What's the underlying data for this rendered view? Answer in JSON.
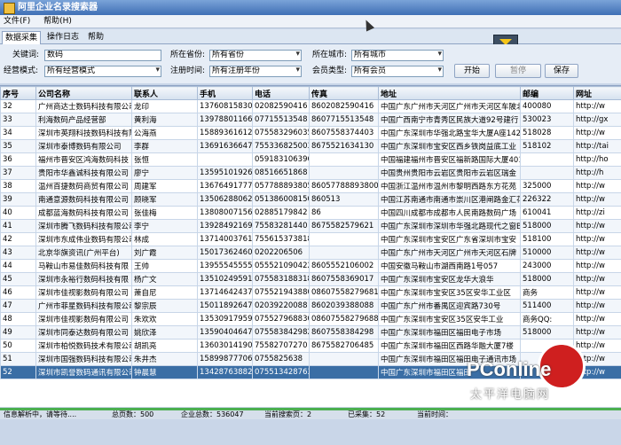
{
  "window": {
    "title": "阿里企业名录搜索器"
  },
  "menu": {
    "file": "文件(F)",
    "help": "帮助(H)"
  },
  "tabs": [
    "数据采集",
    "操作日志",
    "帮助"
  ],
  "form": {
    "keyword_label": "关键词:",
    "keyword_value": "数码",
    "province_label": "所在省份:",
    "province_value": "所有省份",
    "city_label": "所在城市:",
    "city_value": "所有城市",
    "mode_label": "经营模式:",
    "mode_value": "所有经营模式",
    "regtime_label": "注册时间:",
    "regtime_value": "所有注册年份",
    "member_label": "会员类型:",
    "member_value": "所有会员",
    "start_button": "开始",
    "pause_button": "暂停",
    "save_button": "保存"
  },
  "table": {
    "columns": [
      "序号",
      "公司名称",
      "联系人",
      "手机",
      "电话",
      "传真",
      "地址",
      "邮编",
      "网址"
    ],
    "rows": [
      [
        "32",
        "广州商达士数码科技有限公司",
        "龙印",
        "13760815830",
        "02082590416",
        "8602082590416",
        "中国广东广州市天河区广州市天河区车陂北",
        "400080",
        "http://w"
      ],
      [
        "33",
        "利海数码产品经营部",
        "黄利海",
        "13978801166",
        "07715513548",
        "8607715513548",
        "中国广西南宁市青秀区民族大道92号建行",
        "530023",
        "http://gx"
      ],
      [
        "34",
        "深圳市英翔科技数码科技有限",
        "公海燕",
        "15889361612",
        "075583296035",
        "8607558374403",
        "中国广东深圳市华强北路宝华大厦A座1428",
        "518028",
        "http://w"
      ],
      [
        "35",
        "深圳市泰博数码有限公司",
        "李群",
        "13691636647",
        "755336825003368",
        "8675521634130",
        "中国广东深圳市宝安区西乡铁岗益底工业",
        "518102",
        "http://tai"
      ],
      [
        "36",
        "福州市晋安区鸿海数码科技",
        "张恒",
        "",
        "059183106396",
        "",
        "中国福建福州市晋安区福新路国际大厦401",
        "",
        "http://ho"
      ],
      [
        "37",
        "贵阳市华鑫诚科技有限公司",
        "廖宁",
        "13595101926",
        "08516651868",
        "",
        "中国贵州贵阳市云岩区贵阳市云岩区瑞金",
        "",
        "http://h"
      ],
      [
        "38",
        "温州百捷数码商贸有限公司",
        "周建军",
        "13676491777",
        "057788893805888",
        "86057788893800",
        "中国浙江温州市温州市黎明西路东方花苑",
        "325000",
        "http://w"
      ],
      [
        "39",
        "南通意源数码科技有限公司",
        "顾晓军",
        "13506288062",
        "051386008150",
        "860513",
        "中国江苏南通市南通市崇川区港闸路金汇花园",
        "226322",
        "http://w"
      ],
      [
        "40",
        "成都蓝海数码科技有限公司",
        "张佳梅",
        "13808007156",
        "02885179842",
        "86",
        "中国四川成都市成都市人民南路数码广场",
        "610041",
        "http://zi"
      ],
      [
        "41",
        "深圳市腾飞数码科技有限公司",
        "李宁",
        "13928492169",
        "75583281440",
        "8675582579621",
        "中国广东深圳市深圳市华强北路现代之窗B",
        "518000",
        "http://w"
      ],
      [
        "42",
        "深圳市东成伟业数码有限公司",
        "林成",
        "13714003761",
        "75561537381831",
        "",
        "中国广东深圳市宝安区广东省深圳市宝安",
        "518100",
        "http://w"
      ],
      [
        "43",
        "北京华旗资讯(广州平台)",
        "刘广霞",
        "15017362460",
        "0202206506",
        "",
        "中国广东广州市天河区广州市天河区石牌",
        "510000",
        "http://w"
      ],
      [
        "44",
        "马鞍山市易佳数码科技有限",
        "王帅",
        "13955545555",
        "055521090422106",
        "8605552106002",
        "中国安徽马鞍山市湖西南路1号057",
        "243000",
        "http://w"
      ],
      [
        "45",
        "深圳市永裕行数码科技有限",
        "杨广文",
        "13510249591",
        "075583188318801",
        "8607558369017",
        "中国广东深圳市宝安区龙华大浪华",
        "518000",
        "http://w"
      ],
      [
        "46",
        "深圳市佳视影数码有限公司",
        "萧自尼",
        "13714642437",
        "0755219438800",
        "0860755827968163",
        "中国广东深圳市宝安区35区安华工业区",
        "商务",
        "http://w"
      ],
      [
        "47",
        "广州市菲星数码科技有限公司",
        "黎宗辰",
        "15011892647",
        "02039220088",
        "8602039388088",
        "中国广东广州市番禺区迎宾路730号",
        "511400",
        "http://w"
      ],
      [
        "48",
        "深圳市佳视影数码有限公司",
        "朱欢欢",
        "13530917959",
        "075527968830",
        "0860755827968830",
        "中国广东深圳市宝安区35区安华工业",
        "商务QQ:",
        "http://w"
      ],
      [
        "49",
        "深圳市同泰达数码有限公司",
        "姚欣泽",
        "13590404647",
        "075583842982838",
        "8607558384298",
        "中国广东深圳市福田区福田电子市场",
        "518000",
        "http://w"
      ],
      [
        "50",
        "深圳市柏悦数码技术有限公司",
        "胡凯亮",
        "13603014190",
        "75582707270",
        "8675582706485",
        "中国广东深圳市福田区西路华融大厦7楼",
        "",
        "http://w"
      ],
      [
        "51",
        "深圳市国强数码科技有限公司",
        "朱井杰",
        "15899877706",
        "0755825638",
        "",
        "中国广东深圳市福田区福田电子通讯市场",
        "",
        "http://w"
      ],
      [
        "52",
        "深圳市凯誉数码通讯有限公司",
        "钟晨慧",
        "13428763882",
        "075513428763882",
        "",
        "中国广东深圳市福田区福田",
        "",
        "http://w"
      ]
    ]
  },
  "status": {
    "info": "信息解析中，请等待....",
    "total_pages": "总页数：500",
    "enterprise_total": "企业总数：536047",
    "current_page": "当前搜索页：2",
    "collected": "已采集：52",
    "current_time": "当前时间："
  },
  "watermark": {
    "brand": "PConline",
    "cn": "太平洋电脑网"
  }
}
